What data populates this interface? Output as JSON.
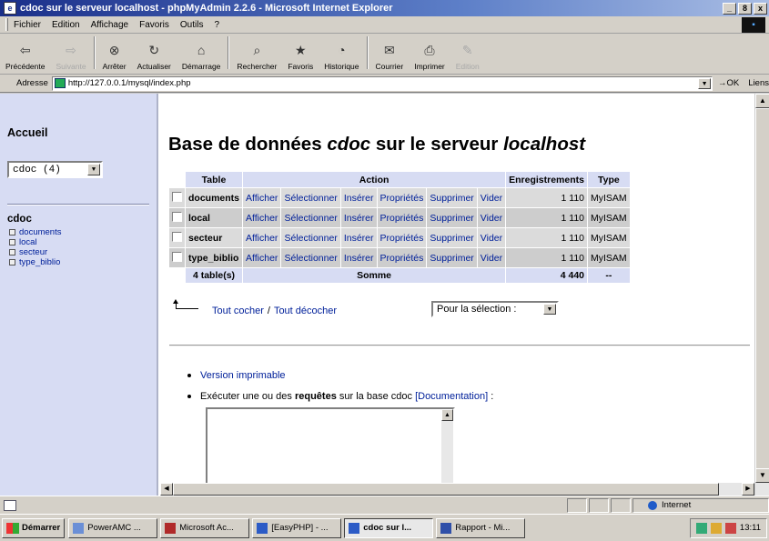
{
  "window": {
    "title": "cdoc sur le serveur localhost - phpMyAdmin 2.2.6 - Microsoft Internet Explorer",
    "buttons": [
      "_",
      "8",
      "x"
    ]
  },
  "menu": {
    "items": [
      "Fichier",
      "Edition",
      "Affichage",
      "Favoris",
      "Outils",
      "?"
    ]
  },
  "toolbar": {
    "items": [
      {
        "label": "Précédente",
        "icon": "back-arrow-icon"
      },
      {
        "label": "Suivante",
        "icon": "forward-arrow-icon"
      },
      {
        "label": "Arrêter",
        "icon": "stop-icon"
      },
      {
        "label": "Actualiser",
        "icon": "refresh-icon"
      },
      {
        "label": "Démarrage",
        "icon": "home-icon"
      },
      {
        "label": "Rechercher",
        "icon": "search-icon"
      },
      {
        "label": "Favoris",
        "icon": "favorites-icon"
      },
      {
        "label": "Historique",
        "icon": "history-icon"
      },
      {
        "label": "Courrier",
        "icon": "mail-icon"
      },
      {
        "label": "Imprimer",
        "icon": "print-icon"
      },
      {
        "label": "Edition",
        "icon": "edit-icon"
      }
    ]
  },
  "address": {
    "label": "Adresse",
    "url": "http://127.0.0.1/mysql/index.php",
    "go": "OK",
    "links": "Liens"
  },
  "left": {
    "home": "Accueil",
    "db_select": "cdoc (4)",
    "db_name": "cdoc",
    "tables": [
      "documents",
      "local",
      "secteur",
      "type_biblio"
    ]
  },
  "main": {
    "title_prefix": "Base de données",
    "db": "cdoc",
    "title_mid": "sur le serveur",
    "host": "localhost",
    "headers": {
      "table": "Table",
      "action": "Action",
      "records": "Enregistrements",
      "type": "Type"
    },
    "actions": [
      "Afficher",
      "Sélectionner",
      "Insérer",
      "Propriétés",
      "Supprimer",
      "Vider"
    ],
    "rows": [
      {
        "name": "documents",
        "records": "1 110",
        "type": "MyISAM"
      },
      {
        "name": "local",
        "records": "1 110",
        "type": "MyISAM"
      },
      {
        "name": "secteur",
        "records": "1 110",
        "type": "MyISAM"
      },
      {
        "name": "type_biblio",
        "records": "1 110",
        "type": "MyISAM"
      }
    ],
    "sum": {
      "count": "4 table(s)",
      "label": "Somme",
      "records": "4 440",
      "type": "--"
    },
    "check_all": "Tout cocher",
    "separator": "/",
    "uncheck_all": "Tout décocher",
    "selection": "Pour la sélection :",
    "print_version": "Version imprimable",
    "query_prefix": "Exécuter une ou des",
    "query_bold": "requêtes",
    "query_suffix": "sur la base cdoc",
    "doc_link": "[Documentation]",
    "query_colon": ":"
  },
  "status": {
    "zone": "Internet"
  },
  "taskbar": {
    "start": "Démarrer",
    "tasks": [
      "PowerAMC ...",
      "Microsoft Ac...",
      "[EasyPHP] - ...",
      "cdoc sur l...",
      "Rapport - Mi..."
    ],
    "clock": "13:11"
  },
  "colors": {
    "link": "#00209a",
    "header_bg": "#d7dcf3",
    "row_odd": "#dbdbdb",
    "row_even": "#cdcdcd"
  }
}
